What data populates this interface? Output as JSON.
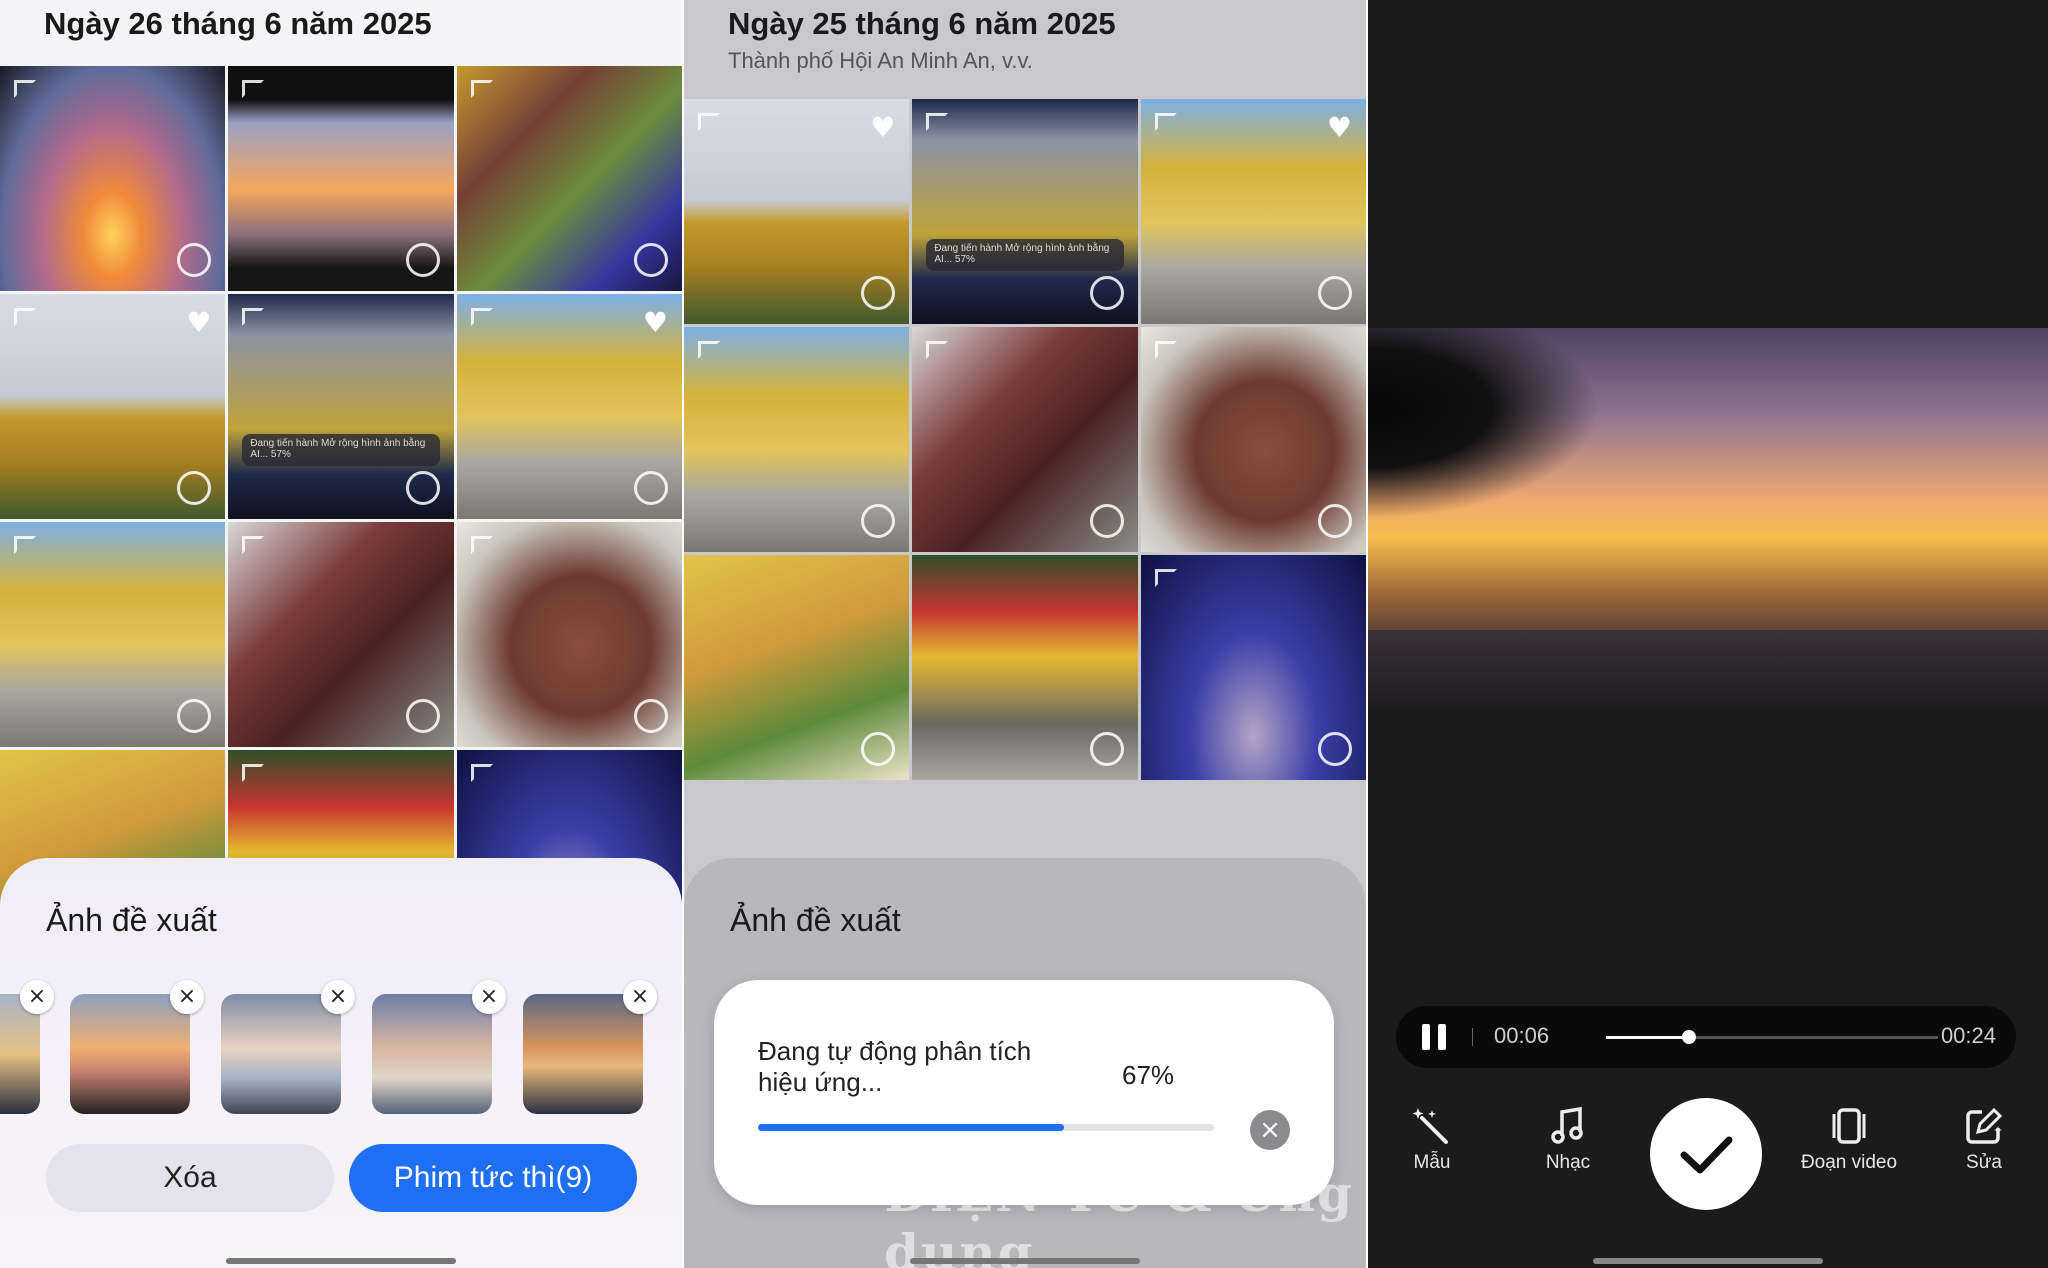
{
  "panel1": {
    "date_title": "Ngày 26 tháng 6 năm 2025",
    "progress_note": "Đang tiến hành Mở rộng hình ảnh bằng AI... 57%",
    "sheet_title": "Ảnh đề xuất",
    "delete_label": "Xóa",
    "instant_movie_label": "Phim tức thì(9)"
  },
  "panel2": {
    "date_title": "Ngày 25 tháng 6 năm 2025",
    "place": "Thành phố Hội An Minh An, v.v.",
    "progress_note": "Đang tiến hành Mở rộng hình ảnh bằng AI... 57%",
    "sheet_title": "Ảnh đề xuất",
    "dialog": {
      "message": "Đang tự động phân tích hiệu ứng...",
      "percent_text": "67%",
      "progress": 0.67
    },
    "watermark": "ĐIỆN TỬ & Ứng dụng"
  },
  "panel3": {
    "current_time": "00:06",
    "total_time": "00:24",
    "playback_progress": 0.25,
    "tools": {
      "template": "Mẫu",
      "music": "Nhạc",
      "clip": "Đoạn video",
      "edit": "Sửa"
    }
  },
  "colors": {
    "accent": "#1f6ff2",
    "dark_bg": "#1b1b1b",
    "white": "#ffffff"
  }
}
